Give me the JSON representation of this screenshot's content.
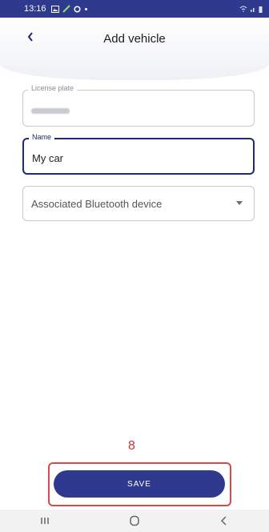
{
  "status_bar": {
    "time": "13:16"
  },
  "header": {
    "title": "Add vehicle"
  },
  "form": {
    "license_plate": {
      "label": "License plate"
    },
    "name": {
      "label": "Name",
      "value": "My car"
    },
    "bluetooth": {
      "placeholder": "Associated Bluetooth device"
    }
  },
  "annotation": {
    "step": "8"
  },
  "actions": {
    "save_label": "SAVE"
  },
  "colors": {
    "primary": "#2f3a8f",
    "highlight": "#d64a4a"
  }
}
